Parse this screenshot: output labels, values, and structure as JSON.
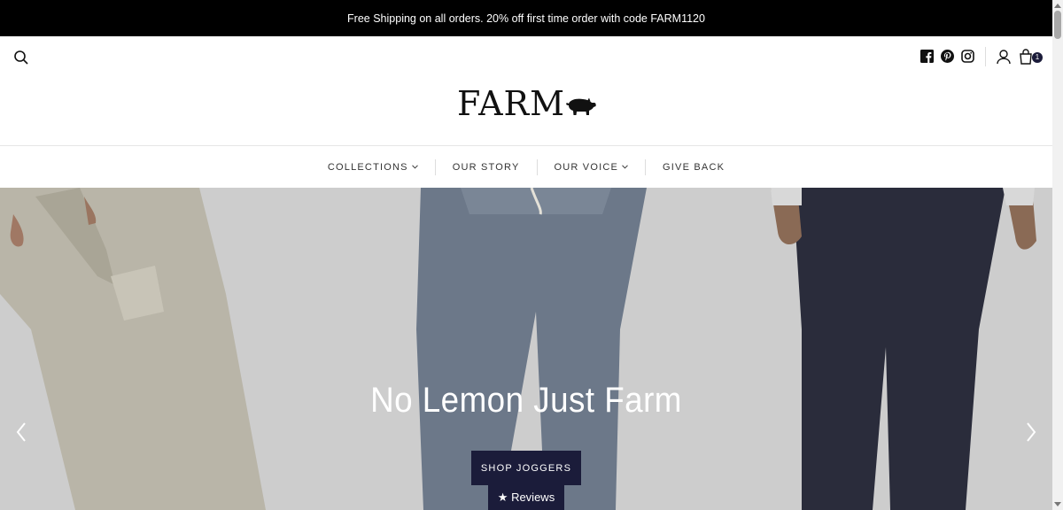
{
  "announcement": {
    "text": "Free Shipping on all orders. 20% off first time order with code FARM1120"
  },
  "header": {
    "logo_text": "FARM",
    "icons": {
      "search": "search-icon",
      "facebook": "facebook-icon",
      "pinterest": "pinterest-icon",
      "instagram": "instagram-icon",
      "account": "user-icon",
      "cart": "shopping-bag-icon"
    },
    "cart_count": "1"
  },
  "nav": {
    "items": [
      {
        "label": "COLLECTIONS",
        "has_dropdown": true
      },
      {
        "label": "OUR STORY",
        "has_dropdown": false
      },
      {
        "label": "OUR VOICE",
        "has_dropdown": true
      },
      {
        "label": "GIVE BACK",
        "has_dropdown": false
      }
    ]
  },
  "hero": {
    "title": "No Lemon Just Farm",
    "cta_label": "SHOP JOGGERS",
    "reviews_label": "★ Reviews",
    "prev_icon": "chevron-left-icon",
    "next_icon": "chevron-right-icon"
  },
  "colors": {
    "announcement_bg": "#000000",
    "accent": "#1b1c3a",
    "hero_bg": "#cdcdcd"
  }
}
